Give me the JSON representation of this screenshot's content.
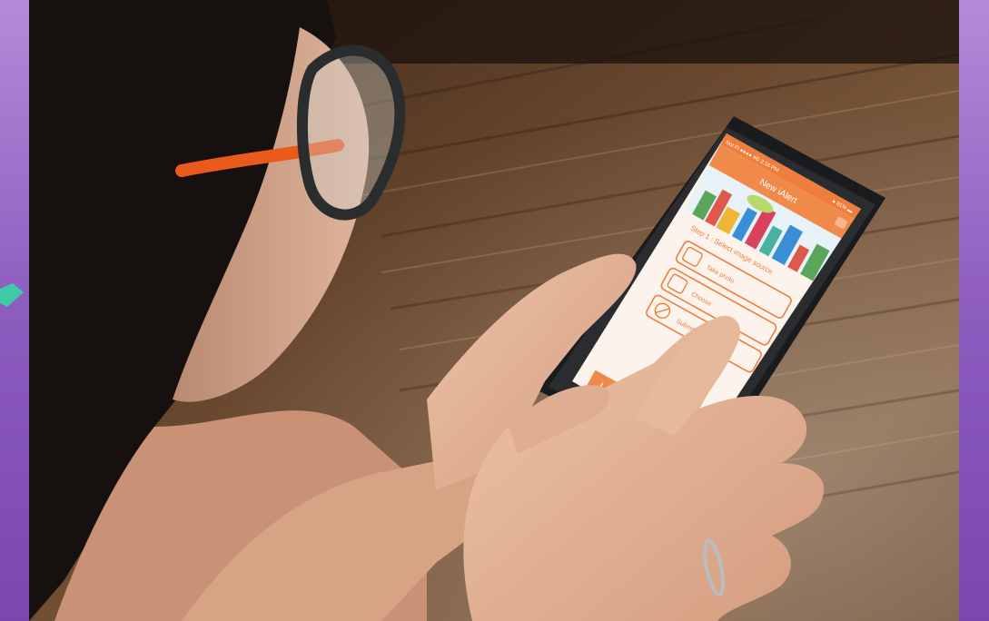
{
  "phone_app": {
    "status_carrier": "Not Fi ●●●● 4G 2:16 PM",
    "status_battery": "● 81% ▬",
    "header_title": "New iAlert",
    "step_title": "Step 1 : Select image source",
    "options": [
      {
        "label": "Take photo",
        "icon": "camera-icon"
      },
      {
        "label": "Choose",
        "icon": "gallery-icon"
      },
      {
        "label": "Submit",
        "icon": "no-image-icon"
      }
    ]
  },
  "colors": {
    "frame_purple": "#8a55b8",
    "accent_teal": "#3ec9a7",
    "app_orange": "#f08a4b",
    "floor_brown": "#5a3a22",
    "skin": "#e3b499",
    "hair": "#1a1412",
    "glasses_orange": "#ea5a1c"
  }
}
